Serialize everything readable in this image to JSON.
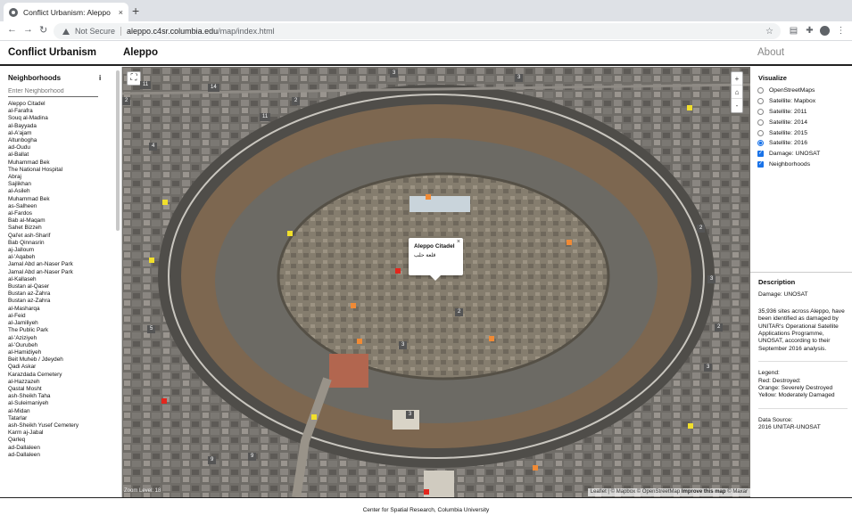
{
  "browser": {
    "tab_title": "Conflict Urbanism: Aleppo",
    "tab_close": "×",
    "new_tab": "+",
    "security": "Not Secure",
    "url_host": "aleppo.c4sr.columbia.edu",
    "url_path": "/map/index.html"
  },
  "header": {
    "brand": "Conflict Urbanism",
    "title": "Aleppo",
    "about": "About"
  },
  "sidebar": {
    "heading": "Neighborhoods",
    "info": "i",
    "search_placeholder": "Enter Neighborhood",
    "neighborhoods": [
      "Aleppo Citadel",
      "al-Farafra",
      "Souq al-Madina",
      "al-Bayyada",
      "al-A'ajam",
      "Altunbogha",
      "ad-Oudu",
      "al-Ballat",
      "Muhammad Bek",
      "The National Hospital",
      "Abraj",
      "Sajlikhan",
      "al-Asileh",
      "Muhammad Bek",
      "as-Salheen",
      "al-Fardos",
      "Bab al-Maqam",
      "Sahet Bizzeh",
      "Qal'et ash-Sharif",
      "Bab Qinnasrin",
      "aj-Jalloum",
      "al-'Aqabeh",
      "Jamal Abd an-Naser Park",
      "Jamal Abd an-Naser Park",
      "al-Kallaseh",
      "Bustan al-Qaser",
      "Bustan az-Zahra",
      "Bustan az-Zahra",
      "al-Masharqa",
      "al-Feid",
      "al-Jamiliyeh",
      "The Public Park",
      "al-'Aziziyeh",
      "al-'Ourubeh",
      "al-Hamidiyeh",
      "Beit Muheb / Jdeydeh",
      "Qadi Askar",
      "Karazdada Cemetery",
      "al-Hazzazeh",
      "Qastal Mosht",
      "ash-Sheikh Taha",
      "al-Suleimaniyeh",
      "al-Midan",
      "Tatarlar",
      "ash-Sheikh Yusef Cemetery",
      "Karm aj-Jabal",
      "Qarleq",
      "ad-Dallaleen",
      "ad-Dallaleen"
    ]
  },
  "map": {
    "fullscreen_icon": "⛶",
    "zoom_in": "+",
    "home": "⌂",
    "zoom_out": "-",
    "zoom_level": "Zoom Level: 18",
    "attribution_pre": "Leaflet | © Mapbox © OpenStreetMap ",
    "attribution_bold": "Improve this map",
    "attribution_post": " © Maxar",
    "popup": {
      "title": "Aleppo Citadel",
      "arabic": "قلعة حلب",
      "close": "×"
    },
    "labels": [
      "11",
      "14",
      "2",
      "3",
      "11",
      "4",
      "2",
      "3",
      "3",
      "2",
      "5",
      "2",
      "3",
      "3",
      "3",
      "2",
      "9",
      "9"
    ],
    "marker_colors": {
      "red": "#e3261d",
      "orange": "#f08a35",
      "yellow": "#f1df2b"
    }
  },
  "visualize": {
    "heading": "Visualize",
    "layers": [
      {
        "label": "OpenStreetMaps",
        "kind": "radio",
        "checked": false
      },
      {
        "label": "Satellite: Mapbox",
        "kind": "radio",
        "checked": false
      },
      {
        "label": "Satellite: 2011",
        "kind": "radio",
        "checked": false
      },
      {
        "label": "Satellite: 2014",
        "kind": "radio",
        "checked": false
      },
      {
        "label": "Satellite: 2015",
        "kind": "radio",
        "checked": false
      },
      {
        "label": "Satellite: 2016",
        "kind": "radio",
        "checked": true
      },
      {
        "label": "Damage: UNOSAT",
        "kind": "checkbox",
        "checked": true
      },
      {
        "label": "Neighborhoods",
        "kind": "checkbox",
        "checked": true
      }
    ]
  },
  "description": {
    "heading": "Description",
    "subtitle": "Damage: UNOSAT",
    "body": "35,936 sites across Aleppo, have been identified as damaged by UNITAR's Operational Satellite Applications Programme, UNOSAT, according to their September 2016 analysis.",
    "legend_title": "Legend:",
    "legend_red": "Red: Destroyed:",
    "legend_orange": "Orange: Severely Destroyed",
    "legend_yellow": "Yellow: Moderately Damaged",
    "source_title": "Data Source:",
    "source": "2016 UNITAR-UNOSAT"
  },
  "footer": {
    "text": "Center for Spatial Research, Columbia University"
  }
}
